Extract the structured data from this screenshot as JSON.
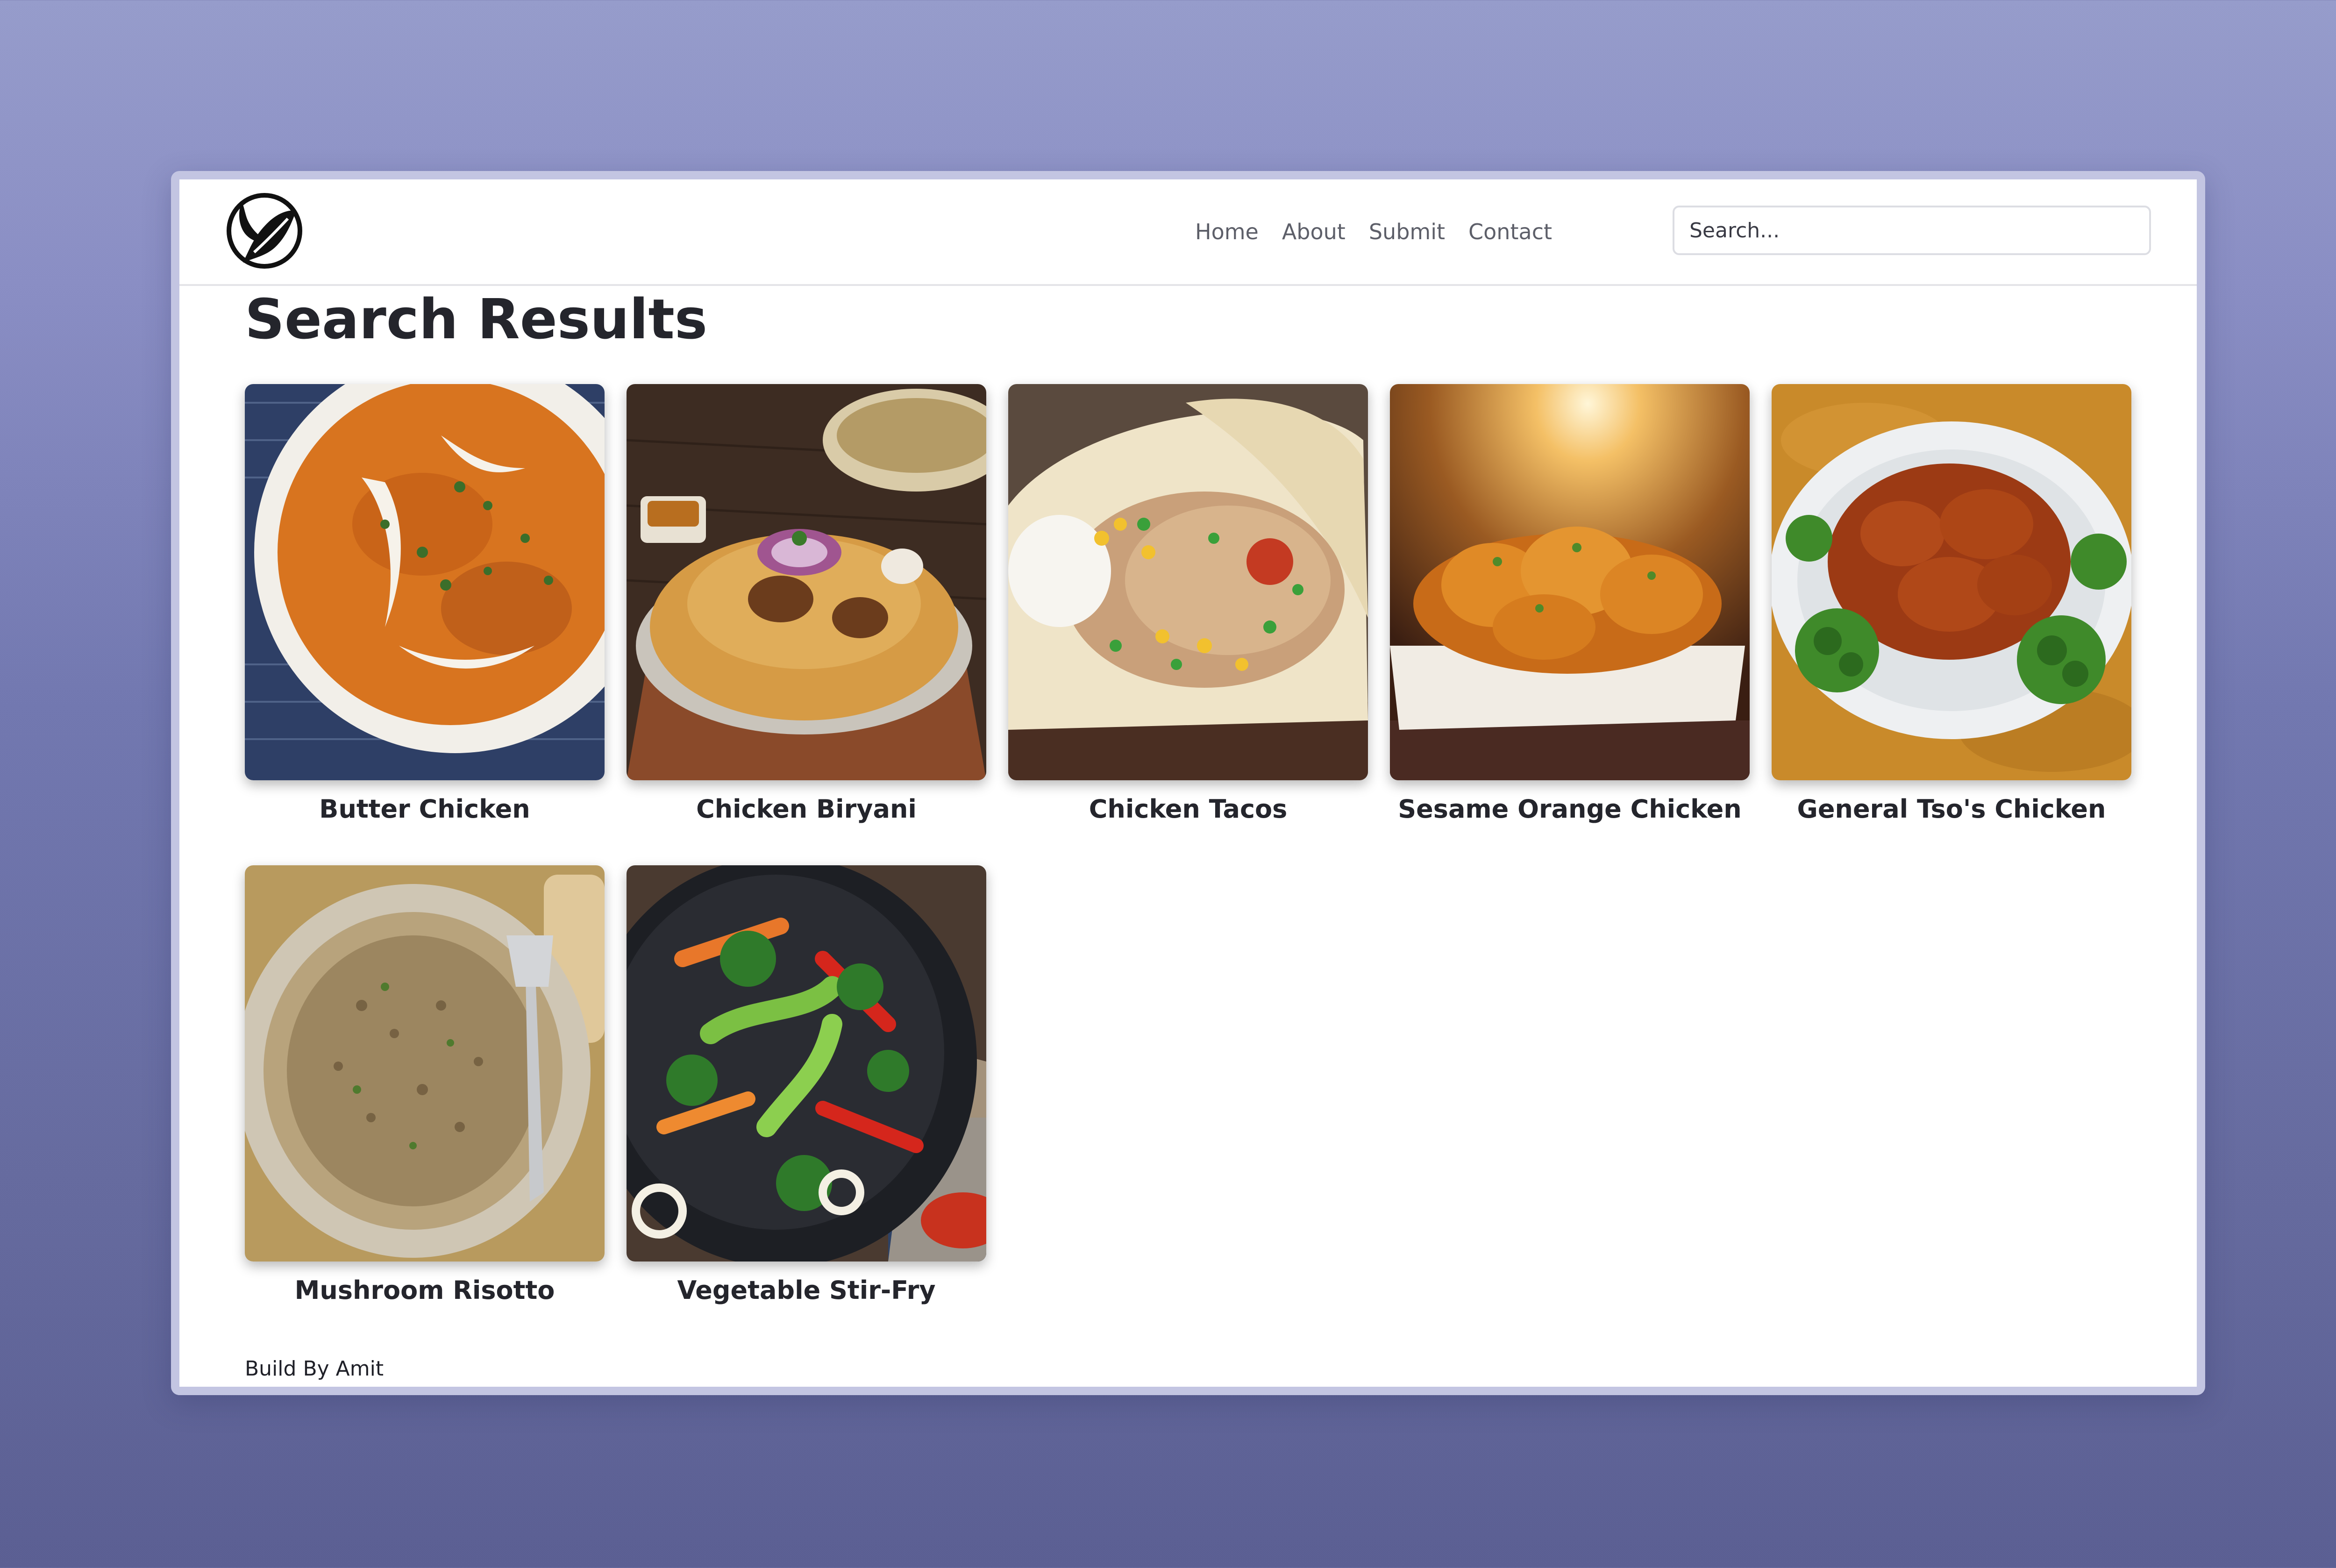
{
  "navbar": {
    "logo_icon": "leaf-circle-logo-icon",
    "links": [
      {
        "label": "Home"
      },
      {
        "label": "About"
      },
      {
        "label": "Submit"
      },
      {
        "label": "Contact"
      }
    ],
    "search": {
      "placeholder": "Search...",
      "value": ""
    }
  },
  "main": {
    "title": "Search Results",
    "results": [
      {
        "title": "Butter Chicken",
        "image": "butter-chicken-photo"
      },
      {
        "title": "Chicken Biryani",
        "image": "chicken-biryani-photo"
      },
      {
        "title": "Chicken Tacos",
        "image": "chicken-tacos-photo"
      },
      {
        "title": "Sesame Orange Chicken",
        "image": "sesame-orange-chicken-photo"
      },
      {
        "title": "General Tso's Chicken",
        "image": "general-tsos-chicken-photo"
      },
      {
        "title": "Mushroom Risotto",
        "image": "mushroom-risotto-photo"
      },
      {
        "title": "Vegetable Stir-Fry",
        "image": "vegetable-stir-fry-photo"
      }
    ]
  },
  "footer": {
    "text": "Build By Amit"
  }
}
